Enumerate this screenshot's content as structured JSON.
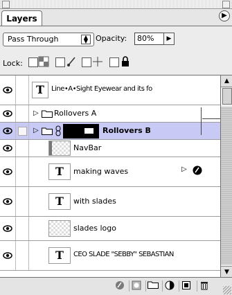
{
  "panel": {
    "tab_label": "Layers",
    "menu_icon": "play-circle-icon"
  },
  "options": {
    "blend_mode": "Pass Through",
    "opacity_label": "Opacity:",
    "opacity_value": "80%",
    "lock_label": "Lock:"
  },
  "layers": [
    {
      "name": "Line•A•Sight Eyewear and its fo",
      "type": "text",
      "visible": true
    },
    {
      "name": "Rollovers A",
      "type": "folder",
      "visible": true
    },
    {
      "name": "Rollovers B",
      "type": "folder",
      "visible": true,
      "selected": true
    },
    {
      "name": "NavBar",
      "type": "image",
      "visible": true
    },
    {
      "name": "making waves",
      "type": "text",
      "visible": true,
      "has_effects": true
    },
    {
      "name": "with slades",
      "type": "text",
      "visible": true
    },
    {
      "name": "slades logo",
      "type": "image",
      "visible": true
    },
    {
      "name": "CEO SLADE \"SEBBY\" SEBASTIAN",
      "type": "text",
      "visible": true
    }
  ],
  "bottom_bar": {
    "buttons": [
      "layer-style-icon",
      "mask-icon",
      "new-set-icon",
      "adjustment-layer-icon",
      "new-layer-icon",
      "trash-icon"
    ]
  },
  "colors": {
    "selected_row": "#c9c9f5",
    "panel_bg": "#e6e6e6"
  }
}
